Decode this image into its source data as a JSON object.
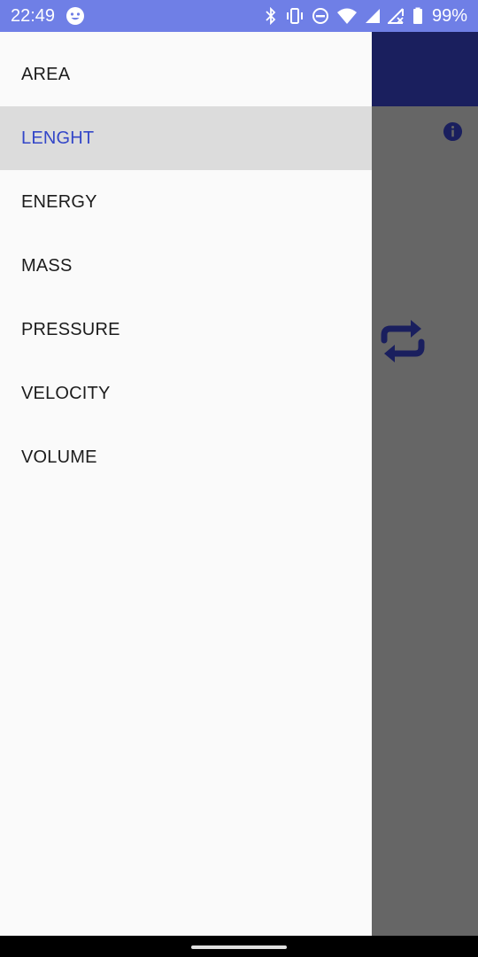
{
  "status_bar": {
    "time": "22:49",
    "battery": "99%",
    "icons": [
      "emoji-icon",
      "bluetooth-icon",
      "vibrate-icon",
      "do-not-disturb-icon",
      "wifi-icon",
      "signal-icon",
      "no-data-signal-icon",
      "battery-icon"
    ]
  },
  "app": {
    "toolbar_color": "#1a1f5e",
    "icons": [
      "info-icon",
      "swap-icon"
    ]
  },
  "drawer": {
    "items": [
      {
        "label": "AREA",
        "selected": false
      },
      {
        "label": "LENGHT",
        "selected": true
      },
      {
        "label": "ENERGY",
        "selected": false
      },
      {
        "label": "MASS",
        "selected": false
      },
      {
        "label": "PRESSURE",
        "selected": false
      },
      {
        "label": "VELOCITY",
        "selected": false
      },
      {
        "label": "VOLUME",
        "selected": false
      }
    ],
    "selected_color": "#3346c8"
  }
}
